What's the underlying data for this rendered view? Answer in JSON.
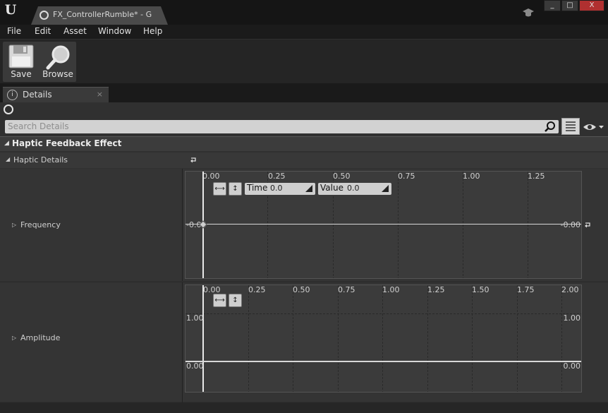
{
  "window": {
    "tab_title": "FX_ControllerRumble* - G",
    "controls": [
      "_",
      "□",
      "X"
    ]
  },
  "menu": [
    "File",
    "Edit",
    "Asset",
    "Window",
    "Help"
  ],
  "toolbar": {
    "save_label": "Save",
    "browse_label": "Browse"
  },
  "details_tab": {
    "label": "Details",
    "close": "×",
    "info_glyph": "i"
  },
  "search": {
    "placeholder": "Search Details"
  },
  "section": {
    "title": "Haptic Feedback Effect",
    "category": "Haptic Details"
  },
  "frequency": {
    "label": "Frequency",
    "x_ticks": [
      "0.00",
      "0.25",
      "0.50",
      "0.75",
      "1.00",
      "1.25"
    ],
    "left_value": "-0.00",
    "right_value": "-0.00",
    "time_label": "Time",
    "time_value": "0.0",
    "value_label": "Value",
    "value_value": "0.0",
    "key_time": 0.0,
    "key_value": 0.0
  },
  "amplitude": {
    "label": "Amplitude",
    "x_ticks": [
      "0.00",
      "0.25",
      "0.50",
      "0.75",
      "1.00",
      "1.25",
      "1.50",
      "1.75",
      "2.00"
    ],
    "y_top_left": "1.00",
    "y_top_right": "1.00",
    "y_zero_left": "0.00",
    "y_zero_right": "0.00"
  },
  "icons": {
    "fit_horizontal": "⟷",
    "fit_vertical": "↕"
  }
}
